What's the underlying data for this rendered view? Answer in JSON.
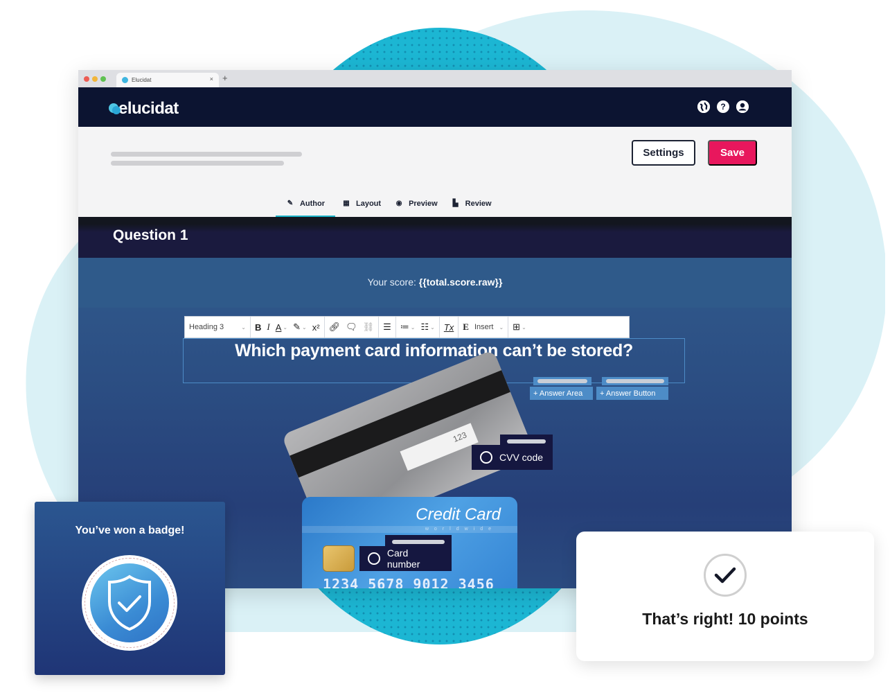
{
  "browser": {
    "tab_title": "Elucidat",
    "tab_close": "×",
    "new_tab": "+"
  },
  "app": {
    "logo_text": "elucidat",
    "header_icons": [
      "globe-icon",
      "help-icon",
      "user-icon"
    ],
    "help_glyph": "?"
  },
  "header": {
    "settings_label": "Settings",
    "save_label": "Save",
    "tabs": [
      {
        "label": "Author",
        "icon": "pencil-icon",
        "glyph": "✎",
        "active": true
      },
      {
        "label": "Layout",
        "icon": "grid-icon",
        "glyph": "▦",
        "active": false
      },
      {
        "label": "Preview",
        "icon": "eye-icon",
        "glyph": "◉",
        "active": false
      },
      {
        "label": "Review",
        "icon": "comment-flag-icon",
        "glyph": "▙",
        "active": false
      }
    ]
  },
  "question": {
    "title": "Question 1",
    "score_prefix": "Your score:",
    "score_variable": "{{total.score.raw}}",
    "heading": "Which payment card information can’t be stored?"
  },
  "toolbar": {
    "style_select": "Heading 3",
    "bold": "B",
    "italic": "I",
    "font_color": "A",
    "superscript": "x²",
    "clear_format": "Tx",
    "insert_glyph": "E",
    "insert_label": "Insert",
    "caret": "⌄"
  },
  "answer_controls": {
    "add_area": "+ Answer Area",
    "add_button": "+ Answer Button"
  },
  "cards": {
    "front_title": "Credit Card",
    "front_subtitle": "worldwide",
    "front_number": "1234 5678 9012 3456",
    "back_cvv": "123"
  },
  "options": [
    {
      "label": "CVV code"
    },
    {
      "label": "Card number"
    }
  ],
  "badge": {
    "title": "You’ve won a badge!"
  },
  "result": {
    "text": "That’s right! 10 points"
  },
  "colors": {
    "accent_teal": "#1ab3c8",
    "save_pink": "#e8175d",
    "app_navy": "#0c1431"
  }
}
